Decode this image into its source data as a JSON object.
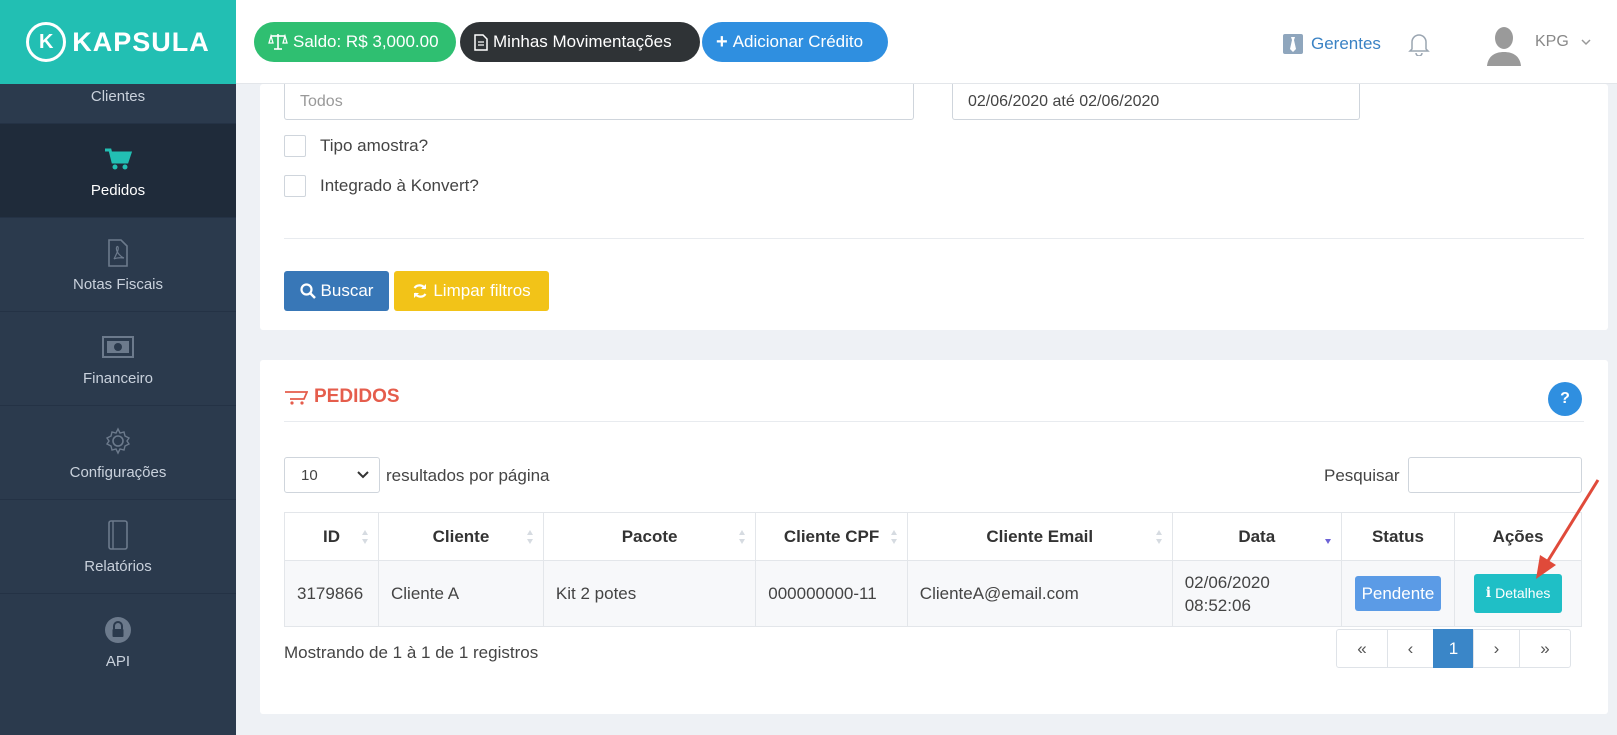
{
  "brand": {
    "name": "KAPSULA",
    "mark": "K"
  },
  "sidebar": {
    "items": [
      {
        "label": "Clientes",
        "icon": "users-icon"
      },
      {
        "label": "Pedidos",
        "icon": "cart-icon"
      },
      {
        "label": "Notas Fiscais",
        "icon": "pdf-file-icon"
      },
      {
        "label": "Financeiro",
        "icon": "money-icon"
      },
      {
        "label": "Configurações",
        "icon": "gear-icon"
      },
      {
        "label": "Relatórios",
        "icon": "notebook-icon"
      },
      {
        "label": "API",
        "icon": "lock-icon"
      }
    ]
  },
  "topbar": {
    "saldo": "Saldo: R$ 3,000.00",
    "movimentacoes": "Minhas Movimentações",
    "adicionar": "Adicionar Crédito",
    "gerentes": "Gerentes",
    "user": "KPG"
  },
  "filters": {
    "status_value": "Todos",
    "date_range": "02/06/2020 até 02/06/2020",
    "check_amostra": "Tipo amostra?",
    "check_konvert": "Integrado à Konvert?",
    "buscar": "Buscar",
    "limpar": "Limpar filtros"
  },
  "orders": {
    "title": "PEDIDOS",
    "help": "?",
    "page_size": "10",
    "per_page_label": "resultados por página",
    "search_label": "Pesquisar",
    "columns": [
      "ID",
      "Cliente",
      "Pacote",
      "Cliente CPF",
      "Cliente Email",
      "Data",
      "Status",
      "Ações"
    ],
    "rows": [
      {
        "id": "3179866",
        "cliente": "Cliente A",
        "pacote": "Kit 2 potes",
        "cpf": "000000000-11",
        "email": "ClienteA@email.com",
        "data_date": "02/06/2020",
        "data_time": "08:52:06",
        "status": "Pendente",
        "action": "Detalhes"
      }
    ],
    "info": "Mostrando de 1 à 1 de 1 registros",
    "pager": {
      "first": "«",
      "prev": "‹",
      "current": "1",
      "next": "›",
      "last": "»"
    }
  },
  "colors": {
    "sidebar": "#2b3a4d",
    "brand": "#22bfb3",
    "accent_red": "#e55d4c",
    "primary": "#3877b7"
  }
}
